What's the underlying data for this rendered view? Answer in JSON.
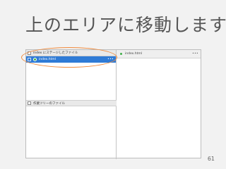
{
  "slide": {
    "title": "上のエリアに移動します",
    "page_number": "61"
  },
  "left_pane": {
    "staged_header": "index にステージしたファイル",
    "selected_file": "index.html",
    "selected_file_menu": "•••",
    "working_header": "作業ツリーのファイル"
  },
  "right_pane": {
    "file_name": "index.html",
    "menu": "•••"
  },
  "colors": {
    "selection": "#2f7bd6",
    "status_dot": "#3fae49",
    "highlight": "#f08a3c"
  }
}
